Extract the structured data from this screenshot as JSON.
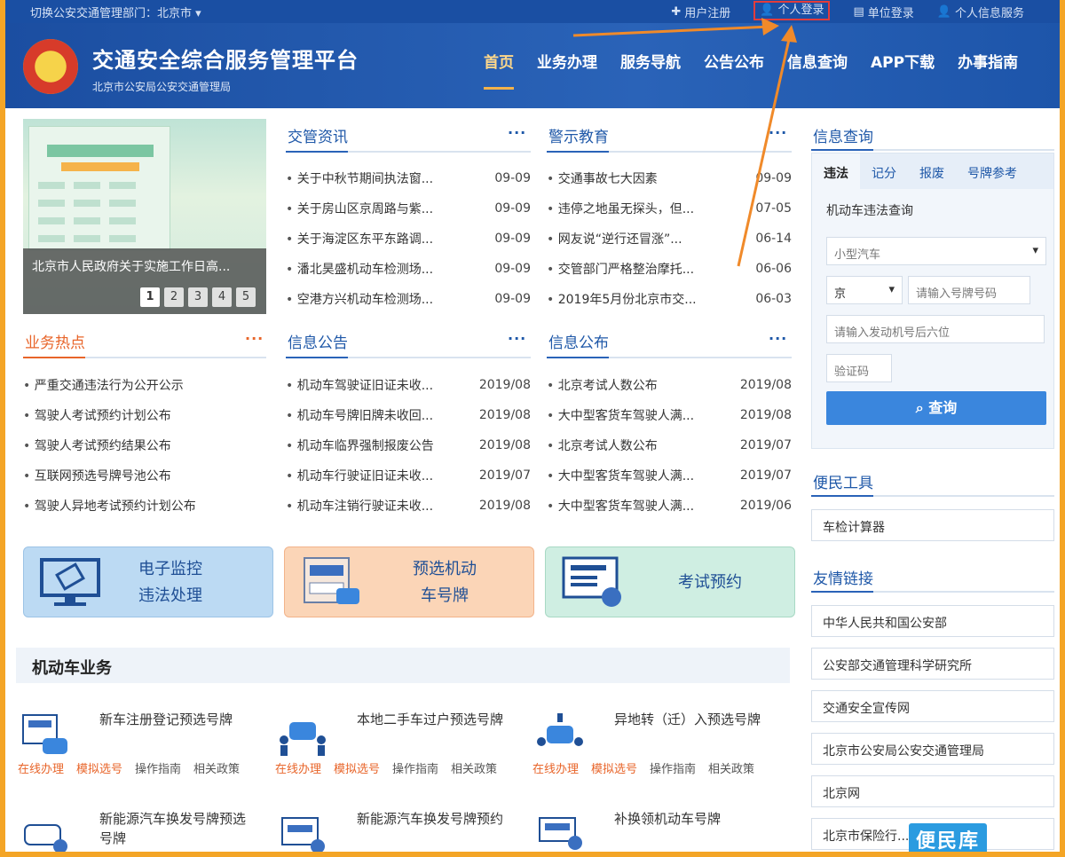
{
  "topbar": {
    "city": "切换公安交通管理部门：北京市 ▾",
    "links": [
      "用户注册",
      "个人登录",
      "单位登录",
      "个人信息服务"
    ]
  },
  "header": {
    "title": "交通安全综合服务管理平台",
    "subtitle": "北京市公安局公安交通管理局",
    "nav": [
      "首页",
      "业务办理",
      "服务导航",
      "公告公布",
      "信息查询",
      "APP下载",
      "办事指南"
    ]
  },
  "banner": {
    "caption": "北京市人民政府关于实施工作日高...",
    "pages": [
      "1",
      "2",
      "3",
      "4",
      "5"
    ]
  },
  "sections": {
    "jgzx": {
      "title": "交管资讯",
      "more": "···",
      "items": [
        {
          "text": "关于中秋节期间执法窗...",
          "date": "09-09"
        },
        {
          "text": "关于房山区京周路与紫...",
          "date": "09-09"
        },
        {
          "text": "关于海淀区东平东路调...",
          "date": "09-09"
        },
        {
          "text": "潘北昊盛机动车检测场...",
          "date": "09-09"
        },
        {
          "text": "空港方兴机动车检测场...",
          "date": "09-09"
        }
      ]
    },
    "jsjy": {
      "title": "警示教育",
      "more": "···",
      "items": [
        {
          "text": "交通事故七大因素",
          "date": "09-09"
        },
        {
          "text": "违停之地虽无探头，但...",
          "date": "07-05"
        },
        {
          "text": "网友说“逆行还冒涨”...",
          "date": "06-14"
        },
        {
          "text": "交管部门严格整治摩托...",
          "date": "06-06"
        },
        {
          "text": "2019年5月份北京市交...",
          "date": "06-03"
        }
      ]
    },
    "ywrd": {
      "title": "业务热点",
      "more": "···",
      "items": [
        {
          "text": "严重交通违法行为公开公示",
          "date": ""
        },
        {
          "text": "驾驶人考试预约计划公布",
          "date": ""
        },
        {
          "text": "驾驶人考试预约结果公布",
          "date": ""
        },
        {
          "text": "互联网预选号牌号池公布",
          "date": ""
        },
        {
          "text": "驾驶人异地考试预约计划公布",
          "date": ""
        }
      ]
    },
    "xxgg": {
      "title": "信息公告",
      "more": "···",
      "items": [
        {
          "text": "机动车驾驶证旧证未收...",
          "date": "2019/08"
        },
        {
          "text": "机动车号牌旧牌未收回...",
          "date": "2019/08"
        },
        {
          "text": "机动车临界强制报废公告",
          "date": "2019/08"
        },
        {
          "text": "机动车行驶证旧证未收...",
          "date": "2019/07"
        },
        {
          "text": "机动车注销行驶证未收...",
          "date": "2019/08"
        }
      ]
    },
    "xxgb": {
      "title": "信息公布",
      "more": "···",
      "items": [
        {
          "text": "北京考试人数公布",
          "date": "2019/08"
        },
        {
          "text": "大中型客货车驾驶人满...",
          "date": "2019/08"
        },
        {
          "text": "北京考试人数公布",
          "date": "2019/07"
        },
        {
          "text": "大中型客货车驾驶人满...",
          "date": "2019/07"
        },
        {
          "text": "大中型客货车驾驶人满...",
          "date": "2019/06"
        }
      ]
    }
  },
  "tiles": {
    "t1": {
      "line1": "电子监控",
      "line2": "违法处理"
    },
    "t2": {
      "line1": "预选机动",
      "line2": "车号牌"
    },
    "t3": {
      "line1": "考试预约",
      "line2": ""
    }
  },
  "motor": {
    "title": "机动车业务",
    "services": [
      {
        "name": "新车注册登记预选号牌",
        "acts": [
          "在线办理",
          "模拟选号",
          "操作指南",
          "相关政策"
        ]
      },
      {
        "name": "本地二手车过户预选号牌",
        "acts": [
          "在线办理",
          "模拟选号",
          "操作指南",
          "相关政策"
        ]
      },
      {
        "name": "异地转（迁）入预选号牌",
        "acts": [
          "在线办理",
          "模拟选号",
          "操作指南",
          "相关政策"
        ]
      },
      {
        "name": "新能源汽车换发号牌预选号牌",
        "acts": []
      },
      {
        "name": "新能源汽车换发号牌预约",
        "acts": []
      },
      {
        "name": "补换领机动车号牌",
        "acts": []
      }
    ]
  },
  "query": {
    "title": "信息查询",
    "tabs": [
      "违法",
      "记分",
      "报废",
      "号牌参考"
    ],
    "subtitle": "机动车违法查询",
    "vehicle_type": "小型汽车",
    "province": "京",
    "plate_placeholder": "请输入号牌号码",
    "engine_placeholder": "请输入发动机号后六位",
    "captcha_placeholder": "验证码",
    "button": "查询"
  },
  "tools": {
    "title": "便民工具",
    "items": [
      "车检计算器"
    ]
  },
  "links": {
    "title": "友情链接",
    "items": [
      "中华人民共和国公安部",
      "公安部交通管理科学研究所",
      "交通安全宣传网",
      "北京市公安局公安交通管理局",
      "北京网",
      "北京市保险行..."
    ]
  },
  "watermark": "便民库"
}
